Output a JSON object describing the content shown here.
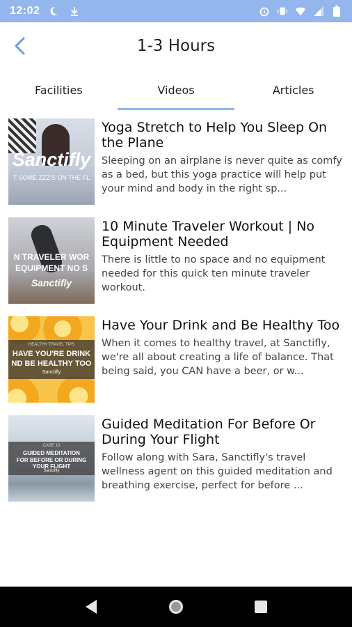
{
  "status_bar": {
    "time": "12:02",
    "color": "#93b6ec",
    "left_icons": [
      "moon-icon",
      "download-icon"
    ],
    "right_icons": [
      "alarm-icon",
      "vibrate-icon",
      "wifi-icon",
      "signal-icon",
      "battery-icon"
    ]
  },
  "header": {
    "title": "1-3 Hours",
    "back_icon": "chevron-left-icon"
  },
  "tabs": [
    {
      "label": "Facilities",
      "active": false
    },
    {
      "label": "Videos",
      "active": true
    },
    {
      "label": "Articles",
      "active": false
    }
  ],
  "videos": [
    {
      "title": "Yoga Stretch to Help You Sleep On the Plane",
      "description": "Sleeping on an airplane is never quite as comfy as a bed, but this yoga practice will help put your mind and body in the right sp...",
      "thumb": {
        "brand": "Sanctifly",
        "caption": "T SOME ZZZ'S ON THE FL"
      }
    },
    {
      "title": "10 Minute Traveler Workout | No Equipment Needed",
      "description": "There is little to no space and no equipment needed for this quick ten minute traveler workout.",
      "thumb": {
        "line1": "N TRAVELER WOR",
        "line2": "EQUIPMENT NO S",
        "brand": "Sanctifly"
      }
    },
    {
      "title": "Have Your Drink and Be Healthy Too",
      "description": "When it comes to healthy travel, at Sanctifly, we're all about creating a life of balance. That being said, you CAN have a beer, or w...",
      "thumb": {
        "small": "HEALTHY TRAVEL TIPS",
        "line1": "HAVE YOU'RE DRINK",
        "line2": "ND BE HEALTHY TOO",
        "brand": "Sanctifly"
      }
    },
    {
      "title": "Guided Meditation For Before Or During Your Flight",
      "description": "Follow along with Sara, Sanctifly's travel wellness agent on this guided meditation and breathing exercise, perfect for before ...",
      "thumb": {
        "small": "CASE 10",
        "line1": "GUIDED MEDITATION",
        "line2": "FOR BEFORE OR DURING",
        "line3": "YOUR FLIGHT",
        "brand": "Sanctifly"
      }
    }
  ],
  "nav_bar": {
    "buttons": [
      "back-triangle-icon",
      "home-circle-icon",
      "recents-square-icon"
    ]
  }
}
